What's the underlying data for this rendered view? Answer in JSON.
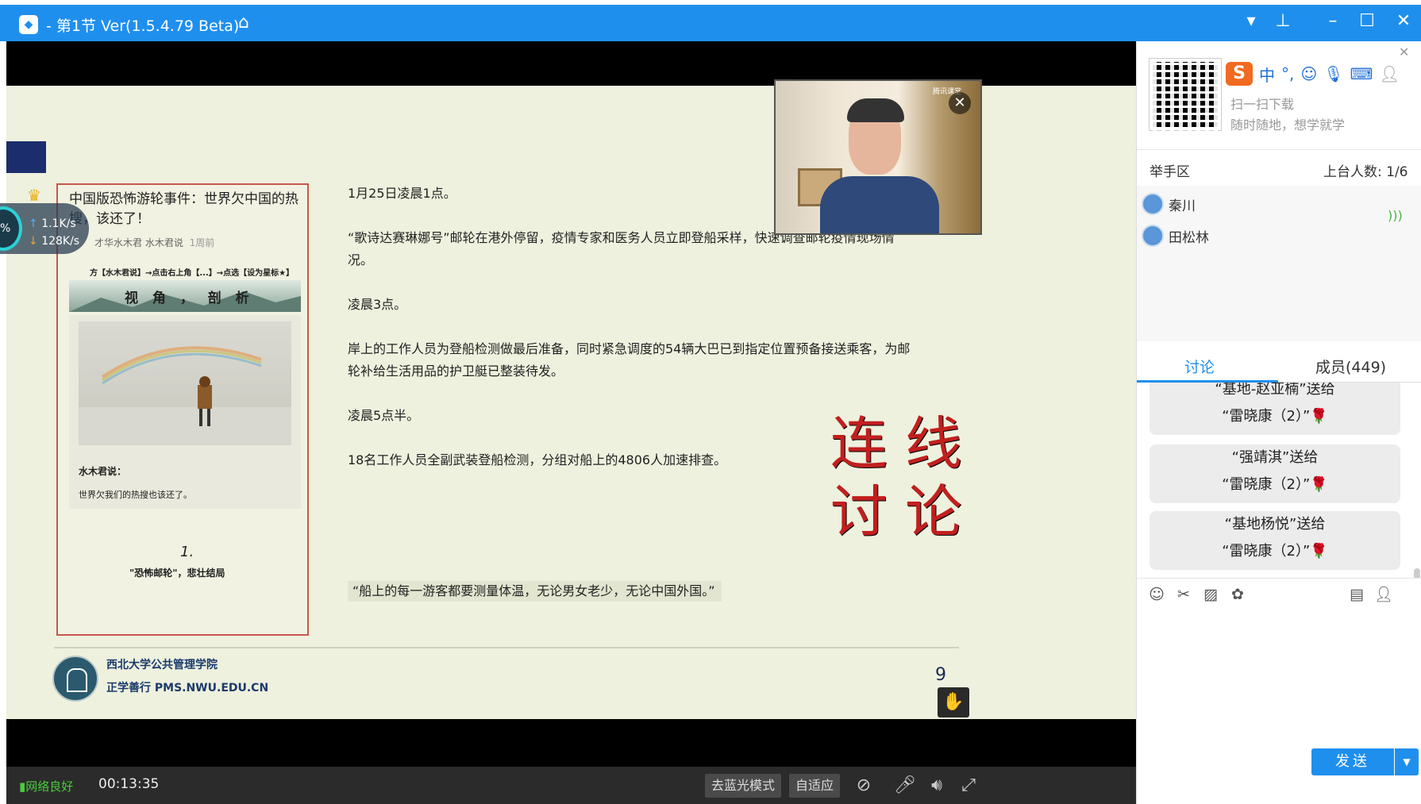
{
  "window": {
    "title": "- 第1节 Ver(1.5.4.79 Beta)",
    "controls": [
      "▾",
      "⊥",
      "–",
      "☐",
      "✕"
    ]
  },
  "slide": {
    "article": {
      "title": "中国版恐怖游轮事件：世界欠中国的热搜，该还了！",
      "meta_author": "才华水木君  水木君说",
      "meta_time": "1周前",
      "follow_hint": "方【水木君说】→点击右上角【...】→点选【设为星标★】",
      "banner": "视 角 ， 剖 析",
      "said_label": "水木君说：",
      "quote": "世界欠我们的热搜也该还了。",
      "number": "1.",
      "caption": "\"恐怖邮轮\"，悲壮结局"
    },
    "paragraphs": [
      "1月25日凌晨1点。",
      "“歌诗达赛琳娜号”邮轮在港外停留，疫情专家和医务人员立即登船采样，快速调查邮轮疫情现场情况。",
      "凌晨3点。",
      "岸上的工作人员为登船检测做最后准备，同时紧急调度的54辆大巴已到指定位置预备接送乘客，为邮轮补给生活用品的护卫艇已整装待发。",
      "凌晨5点半。",
      "18名工作人员全副武装登船检测，分组对船上的4806人加速排查。"
    ],
    "highlight": "“船上的每一游客都要测量体温，无论男女老少，无论中国外国。”",
    "big_text_1": "连线",
    "big_text_2": "讨论",
    "footer_school": "西北大学公共管理学院",
    "footer_site": "正学善行 PMS.NWU.EDU.CN",
    "page_number": "9"
  },
  "webcam": {
    "brand": "腾讯课堂"
  },
  "network_widget": {
    "percent": "%",
    "upload": "1.1K/s",
    "download": "128K/s"
  },
  "bottom_bar": {
    "network_status": "网络良好",
    "elapsed": "00:13:35",
    "bluray_button": "去蓝光模式",
    "fit_button": "自适应"
  },
  "side_panel": {
    "qr_line1": "扫一扫下载",
    "qr_line2": "随时随地，想学就学",
    "ime_label": "中",
    "raise_hand_title": "举手区",
    "on_stage_count": "上台人数: 1/6",
    "members": [
      "秦川",
      "田松林"
    ],
    "tab_discussion": "讨论",
    "tab_members": "成员(449)",
    "messages": [
      {
        "line1": "“基地-赵亚楠”送给",
        "line2": "“雷晓康（2）”🌹"
      },
      {
        "line1": "“强靖淇”送给",
        "line2": "“雷晓康（2）”🌹"
      },
      {
        "line1": "“基地杨悦”送给",
        "line2": "“雷晓康（2）”🌹"
      }
    ],
    "send_label": "发送"
  }
}
